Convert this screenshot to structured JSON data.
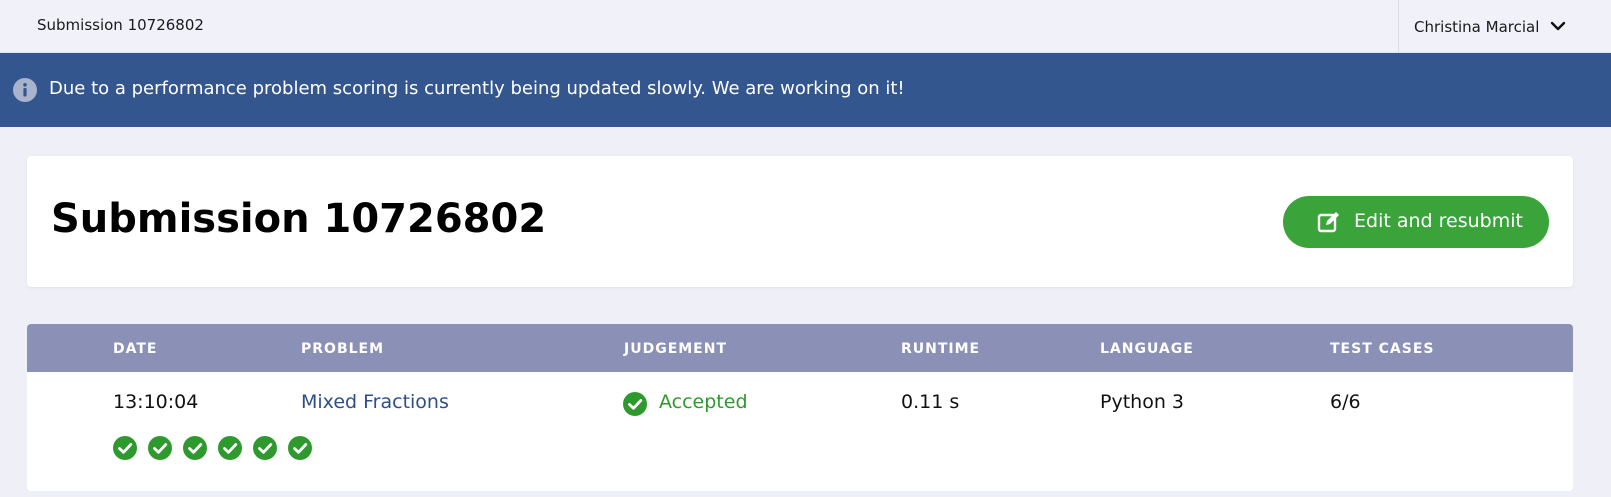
{
  "topbar": {
    "crumb": "Submission 10726802",
    "user_name": "Christina Marcial"
  },
  "banner": {
    "message": "Due to a performance problem scoring is currently being updated slowly. We are working on it!"
  },
  "header": {
    "title": "Submission 10726802",
    "resubmit_label": "Edit and resubmit"
  },
  "table": {
    "columns": [
      "DATE",
      "PROBLEM",
      "JUDGEMENT",
      "RUNTIME",
      "LANGUAGE",
      "TEST CASES"
    ],
    "row": {
      "date": "13:10:04",
      "problem": "Mixed Fractions",
      "judgement": "Accepted",
      "runtime": "0.11 s",
      "language": "Python 3",
      "test_cases": "6/6"
    },
    "test_case_results": [
      "passed",
      "passed",
      "passed",
      "passed",
      "passed",
      "passed"
    ]
  },
  "colors": {
    "banner": "#34568f",
    "accent_green": "#3aa43a",
    "table_header": "#8b91b6",
    "link": "#2d4e8a"
  },
  "icons": {
    "banner": "info-icon",
    "user_menu": "chevron-down-icon",
    "resubmit": "edit-icon",
    "judgement": "check-circle-icon",
    "test_case": "check-circle-icon"
  }
}
